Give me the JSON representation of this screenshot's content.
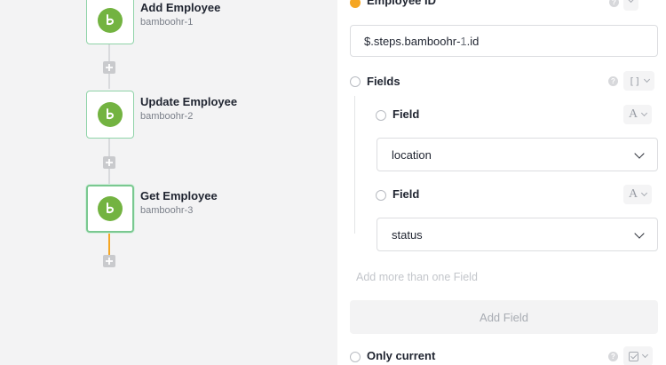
{
  "workflow": {
    "steps": [
      {
        "title": "Add Employee",
        "subtitle": "bamboohr-1",
        "icon": "bamboohr-logo-icon"
      },
      {
        "title": "Update Employee",
        "subtitle": "bamboohr-2",
        "icon": "bamboohr-logo-icon"
      },
      {
        "title": "Get Employee",
        "subtitle": "bamboohr-3",
        "icon": "bamboohr-logo-icon",
        "selected": true
      }
    ],
    "colors": {
      "active_connector": "#f5a623",
      "logo": "#73b341",
      "tile_border": "#8fd3a8"
    }
  },
  "config": {
    "employee_id": {
      "label": "Employee ID",
      "value_prefix": "$.steps.bamboohr-",
      "value_num": "1",
      "value_suffix": ".id"
    },
    "fields": {
      "label": "Fields",
      "type_icon": "[]",
      "items": [
        {
          "label": "Field",
          "type_icon": "A",
          "value": "location"
        },
        {
          "label": "Field",
          "type_icon": "A",
          "value": "status"
        }
      ],
      "hint": "Add more than one Field",
      "add_button": "Add Field"
    },
    "only_current": {
      "label": "Only current"
    }
  }
}
